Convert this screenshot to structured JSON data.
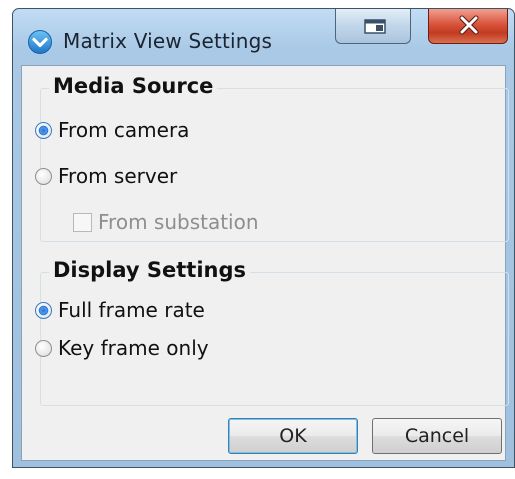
{
  "window": {
    "title": "Matrix View Settings",
    "icons": {
      "app": "chevron-badge-icon",
      "restore": "restore-icon",
      "close": "close-x-icon"
    }
  },
  "media_source": {
    "title": "Media Source",
    "options": [
      {
        "label": "From camera",
        "checked": true
      },
      {
        "label": "From server",
        "checked": false
      }
    ],
    "substation": {
      "label": "From substation",
      "checked": false,
      "enabled": false
    }
  },
  "display_settings": {
    "title": "Display Settings",
    "options": [
      {
        "label": "Full frame rate",
        "checked": true
      },
      {
        "label": "Key frame only",
        "checked": false
      }
    ]
  },
  "buttons": {
    "ok": "OK",
    "cancel": "Cancel"
  },
  "colors": {
    "title_bar": "#a9c9e6",
    "close_button": "#c9432a",
    "dialog_bg": "#f0f0f0",
    "radio_dot": "#2a6fd0"
  }
}
